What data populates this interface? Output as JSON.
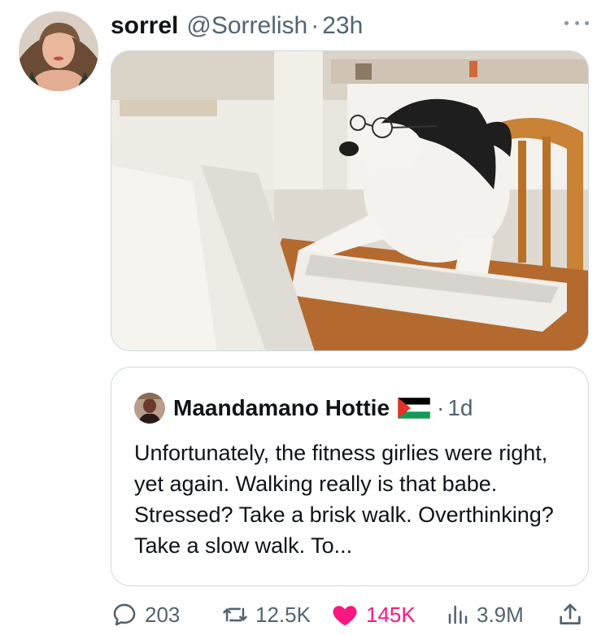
{
  "post": {
    "display_name": "sorrel",
    "handle": "@Sorrelish",
    "separator": "·",
    "time": "23h"
  },
  "quote": {
    "display_name": "Maandamano Hottie",
    "separator": "·",
    "time": "1d",
    "text": "Unfortunately, the fitness girlies were right, yet again. Walking really is that babe. Stressed? Take a brisk walk. Overthinking? Take a slow walk. To..."
  },
  "actions": {
    "replies": "203",
    "reposts": "12.5K",
    "likes": "145K",
    "views": "3.9M"
  },
  "colors": {
    "text": "#0f1419",
    "muted": "#536471",
    "border": "#cfd9de",
    "like": "#f91880"
  },
  "icons": [
    "more-icon",
    "reply-icon",
    "repost-icon",
    "heart-icon",
    "views-icon",
    "share-icon"
  ]
}
